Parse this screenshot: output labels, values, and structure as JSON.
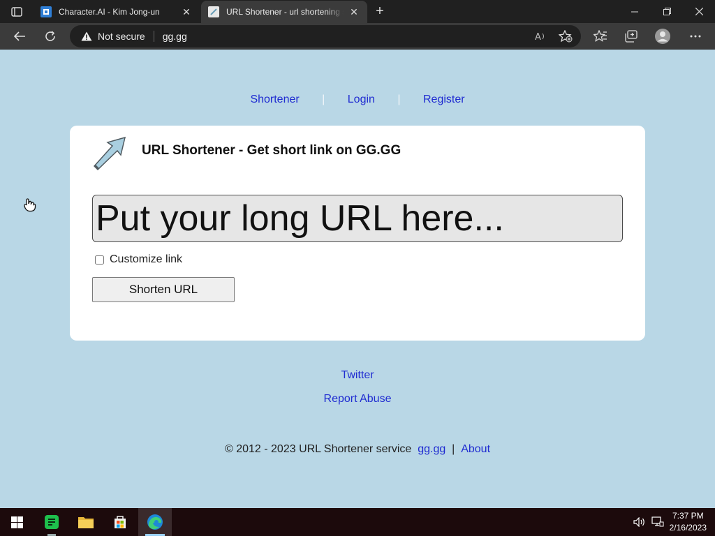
{
  "browser": {
    "tabs": [
      {
        "title": "Character.AI - Kim Jong-un",
        "active": false
      },
      {
        "title": "URL Shortener - url shortening se",
        "active": true
      }
    ],
    "security_label": "Not secure",
    "url": "gg.gg"
  },
  "page": {
    "nav": [
      {
        "label": "Shortener"
      },
      {
        "label": "Login"
      },
      {
        "label": "Register"
      }
    ],
    "nav_separator": "|",
    "card": {
      "title": "URL Shortener - Get short link on GG.GG",
      "input_placeholder": "Put your long URL here...",
      "customize_label": "Customize link",
      "customize_checked": false,
      "shorten_button": "Shorten URL"
    },
    "footer": {
      "twitter": "Twitter",
      "report_abuse": "Report Abuse",
      "copyright_text": "© 2012 - 2023 URL Shortener service",
      "home_link": "gg.gg",
      "separator": "|",
      "about_link": "About"
    }
  },
  "taskbar": {
    "time": "7:37 PM",
    "date": "2/16/2023"
  },
  "colors": {
    "page_bg": "#b9d7e6",
    "link": "#1f2bd1",
    "card_bg": "#ffffff",
    "chrome_dark": "#202020",
    "chrome_toolbar": "#3b3b3b"
  }
}
